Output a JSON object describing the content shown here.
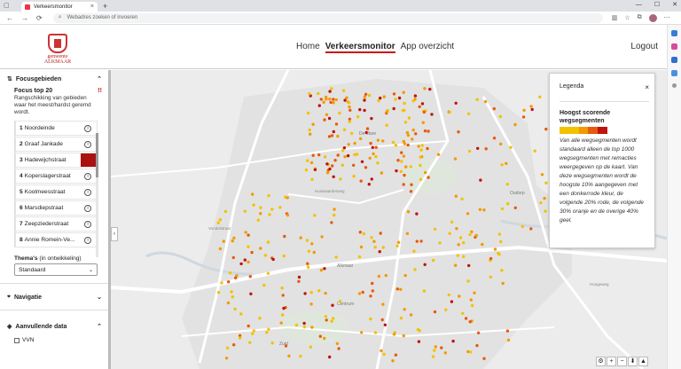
{
  "browser": {
    "tab_title": "Verkeersmonitor",
    "close_glyph": "×",
    "new_tab_glyph": "+",
    "address_placeholder": "Webadres zoeken of invoeren",
    "window_controls": [
      "—",
      "☐",
      "✕"
    ],
    "nav_glyphs": [
      "←",
      "→",
      "⟳"
    ]
  },
  "header": {
    "logo_text": "gemeente ALKMAAR",
    "nav": [
      {
        "label": "Home",
        "active": false
      },
      {
        "label": "Verkeersmonitor",
        "active": true
      },
      {
        "label": "App overzicht",
        "active": false
      }
    ],
    "logout_label": "Logout"
  },
  "panel": {
    "focus_header": "Focusgebieden",
    "focus_title": "Focus top 20",
    "focus_warn": "!!",
    "focus_desc": "Rangschikking van gebieden waar het meest/hardst geremd wordt.",
    "items": [
      {
        "rank": "1",
        "name": "Noordeinde"
      },
      {
        "rank": "2",
        "name": "Graaf Jankade"
      },
      {
        "rank": "3",
        "name": "Hadewijchstraat",
        "selected": true
      },
      {
        "rank": "4",
        "name": "Koperslagerstraat"
      },
      {
        "rank": "5",
        "name": "Koolmeesstraat"
      },
      {
        "rank": "6",
        "name": "Marsdiepstraat"
      },
      {
        "rank": "7",
        "name": "Zeepziederstraat"
      },
      {
        "rank": "8",
        "name": "Annie Romein-Ve..."
      }
    ],
    "themas_label": "Thema's",
    "themas_note": "(in ontwikkeling)",
    "themas_value": "Standaard",
    "navigatie_header": "Navigatie",
    "aanvullende_header": "Aanvullende data",
    "checkbox_vvn": "VVN"
  },
  "legend": {
    "title": "Legenda",
    "close": "×",
    "heading": "Hoogst scorende wegsegmenten",
    "colors": [
      "#f2c200",
      "#f2c200",
      "#f29a00",
      "#e85a0c",
      "#c0130f"
    ],
    "description": "Van alle wegsegmenten wordt standaard alleen de top 1000 wegsegmenten met remacties weergegeven op de kaart. Van deze wegsegmenten wordt de hoogste 10% aangegeven met een donkerrode kleur, de volgende 20% rode, de volgende 30% oranje en de overige 40% geel."
  },
  "map": {
    "labels": [
      "De Mare",
      "Alkmaar",
      "Oudorp",
      "Centrum",
      "Huiswaarderweg",
      "Vondelstraat",
      "Hoogeweg",
      "Zuid"
    ],
    "collapse_glyph": "‹",
    "controls": [
      "⚙",
      "+",
      "−",
      "⬇",
      "▲"
    ]
  }
}
